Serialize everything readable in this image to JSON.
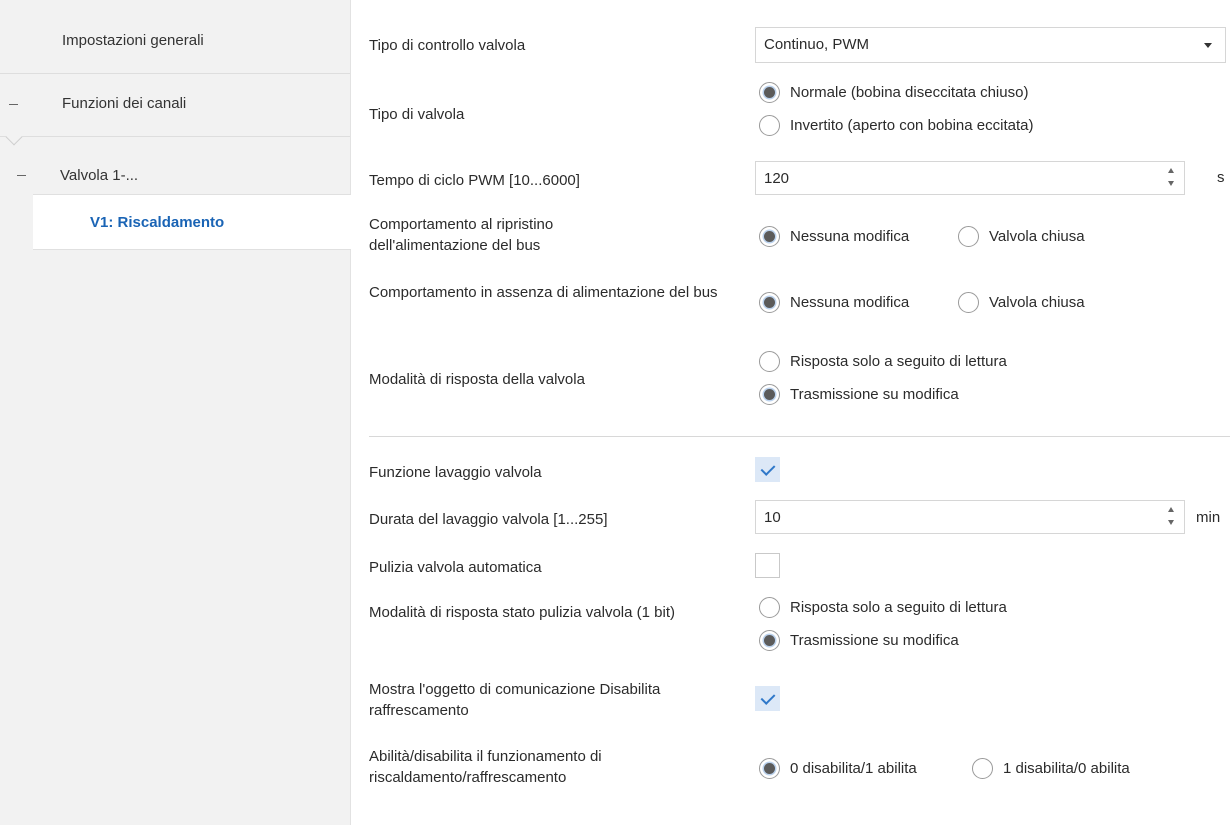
{
  "sidebar": {
    "items": [
      {
        "label": "Impostazioni generali"
      },
      {
        "label": "Funzioni dei canali"
      },
      {
        "label": "Valvola 1-..."
      },
      {
        "label": "V1: Riscaldamento"
      }
    ]
  },
  "settings": {
    "tipo_controllo": {
      "label": "Tipo di controllo valvola",
      "value": "Continuo, PWM"
    },
    "tipo_valvola": {
      "label": "Tipo di valvola",
      "options": [
        "Normale (bobina diseccitata chiuso)",
        "Invertito (aperto con bobina eccitata)"
      ],
      "selected": 0
    },
    "tempo_ciclo": {
      "label": "Tempo di ciclo PWM [10...6000]",
      "value": "120",
      "unit": "s"
    },
    "ripristino": {
      "label": "Comportamento al ripristino dell'alimentazione del bus",
      "options": [
        "Nessuna modifica",
        "Valvola chiusa"
      ],
      "selected": 0
    },
    "assenza": {
      "label": "Comportamento in assenza di alimentazione del bus",
      "options": [
        "Nessuna modifica",
        "Valvola chiusa"
      ],
      "selected": 0
    },
    "risposta": {
      "label": "Modalità di risposta della valvola",
      "options": [
        "Risposta solo a seguito di lettura",
        "Trasmissione su modifica"
      ],
      "selected": 1
    },
    "lavaggio": {
      "label": "Funzione lavaggio valvola",
      "checked": true
    },
    "durata_lavaggio": {
      "label": "Durata del lavaggio valvola [1...255]",
      "value": "10",
      "unit": "min"
    },
    "pulizia": {
      "label": "Pulizia valvola automatica",
      "checked": false
    },
    "risposta_pulizia": {
      "label": "Modalità di risposta stato pulizia valvola (1 bit)",
      "options": [
        "Risposta solo a seguito di lettura",
        "Trasmissione su modifica"
      ],
      "selected": 1
    },
    "mostra_oggetto": {
      "label": "Mostra l'oggetto di comunicazione Disabilita raffrescamento",
      "checked": true
    },
    "abilita": {
      "label": "Abilità/disabilita il funzionamento di riscaldamento/raffrescamento",
      "options": [
        "0 disabilita/1 abilita",
        "1 disabilita/0 abilita"
      ],
      "selected": 0
    }
  }
}
